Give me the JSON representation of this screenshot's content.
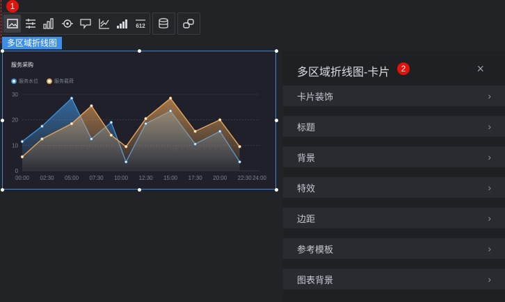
{
  "toolbar": {
    "group1": [
      {
        "icon": "image-icon",
        "active": true
      },
      {
        "icon": "sliders-icon"
      },
      {
        "icon": "bar-chart-icon"
      },
      {
        "icon": "target-icon"
      },
      {
        "icon": "flag-icon"
      },
      {
        "icon": "line-axis-icon"
      },
      {
        "icon": "ascending-bars-icon"
      },
      {
        "icon": "number-display-icon",
        "text": "612"
      }
    ],
    "group2": [
      {
        "icon": "database-icon"
      }
    ],
    "group3": [
      {
        "icon": "link-icon"
      }
    ],
    "badge1": "1"
  },
  "selection_tag": "多区域折线图",
  "chart_data": {
    "type": "area",
    "title": "服务采购",
    "categories": [
      "00:00",
      "02:30",
      "05:00",
      "07:30",
      "10:00",
      "12:30",
      "15:00",
      "17:30",
      "20:00",
      "22:30",
      "24:00"
    ],
    "x_points": [
      "00:00",
      "02:00",
      "05:00",
      "07:00",
      "09:00",
      "10:30",
      "12:30",
      "15:00",
      "17:30",
      "20:00",
      "22:00",
      "24:00"
    ],
    "series": [
      {
        "name": "服务水位",
        "color": "#3f8fd8",
        "values": [
          11.5,
          17.5,
          28.5,
          12.5,
          19,
          3.5,
          18.5,
          23.5,
          10.5,
          15.5,
          3.5
        ]
      },
      {
        "name": "服务载荷",
        "color": "#e8a55a",
        "values": [
          5.5,
          12.5,
          18.5,
          25.5,
          14,
          9.5,
          20.5,
          28.5,
          15.5,
          20,
          9.5
        ]
      }
    ],
    "yticks": [
      0,
      10,
      20,
      30
    ],
    "ylim": [
      0,
      30
    ],
    "grid": true,
    "legend": "top-left"
  },
  "panel": {
    "title": "多区域折线图-卡片",
    "badge": "2",
    "close": "×",
    "items": [
      "卡片装饰",
      "标题",
      "背景",
      "特效",
      "边距",
      "参考模板",
      "图表背景"
    ],
    "chevron": "›"
  }
}
